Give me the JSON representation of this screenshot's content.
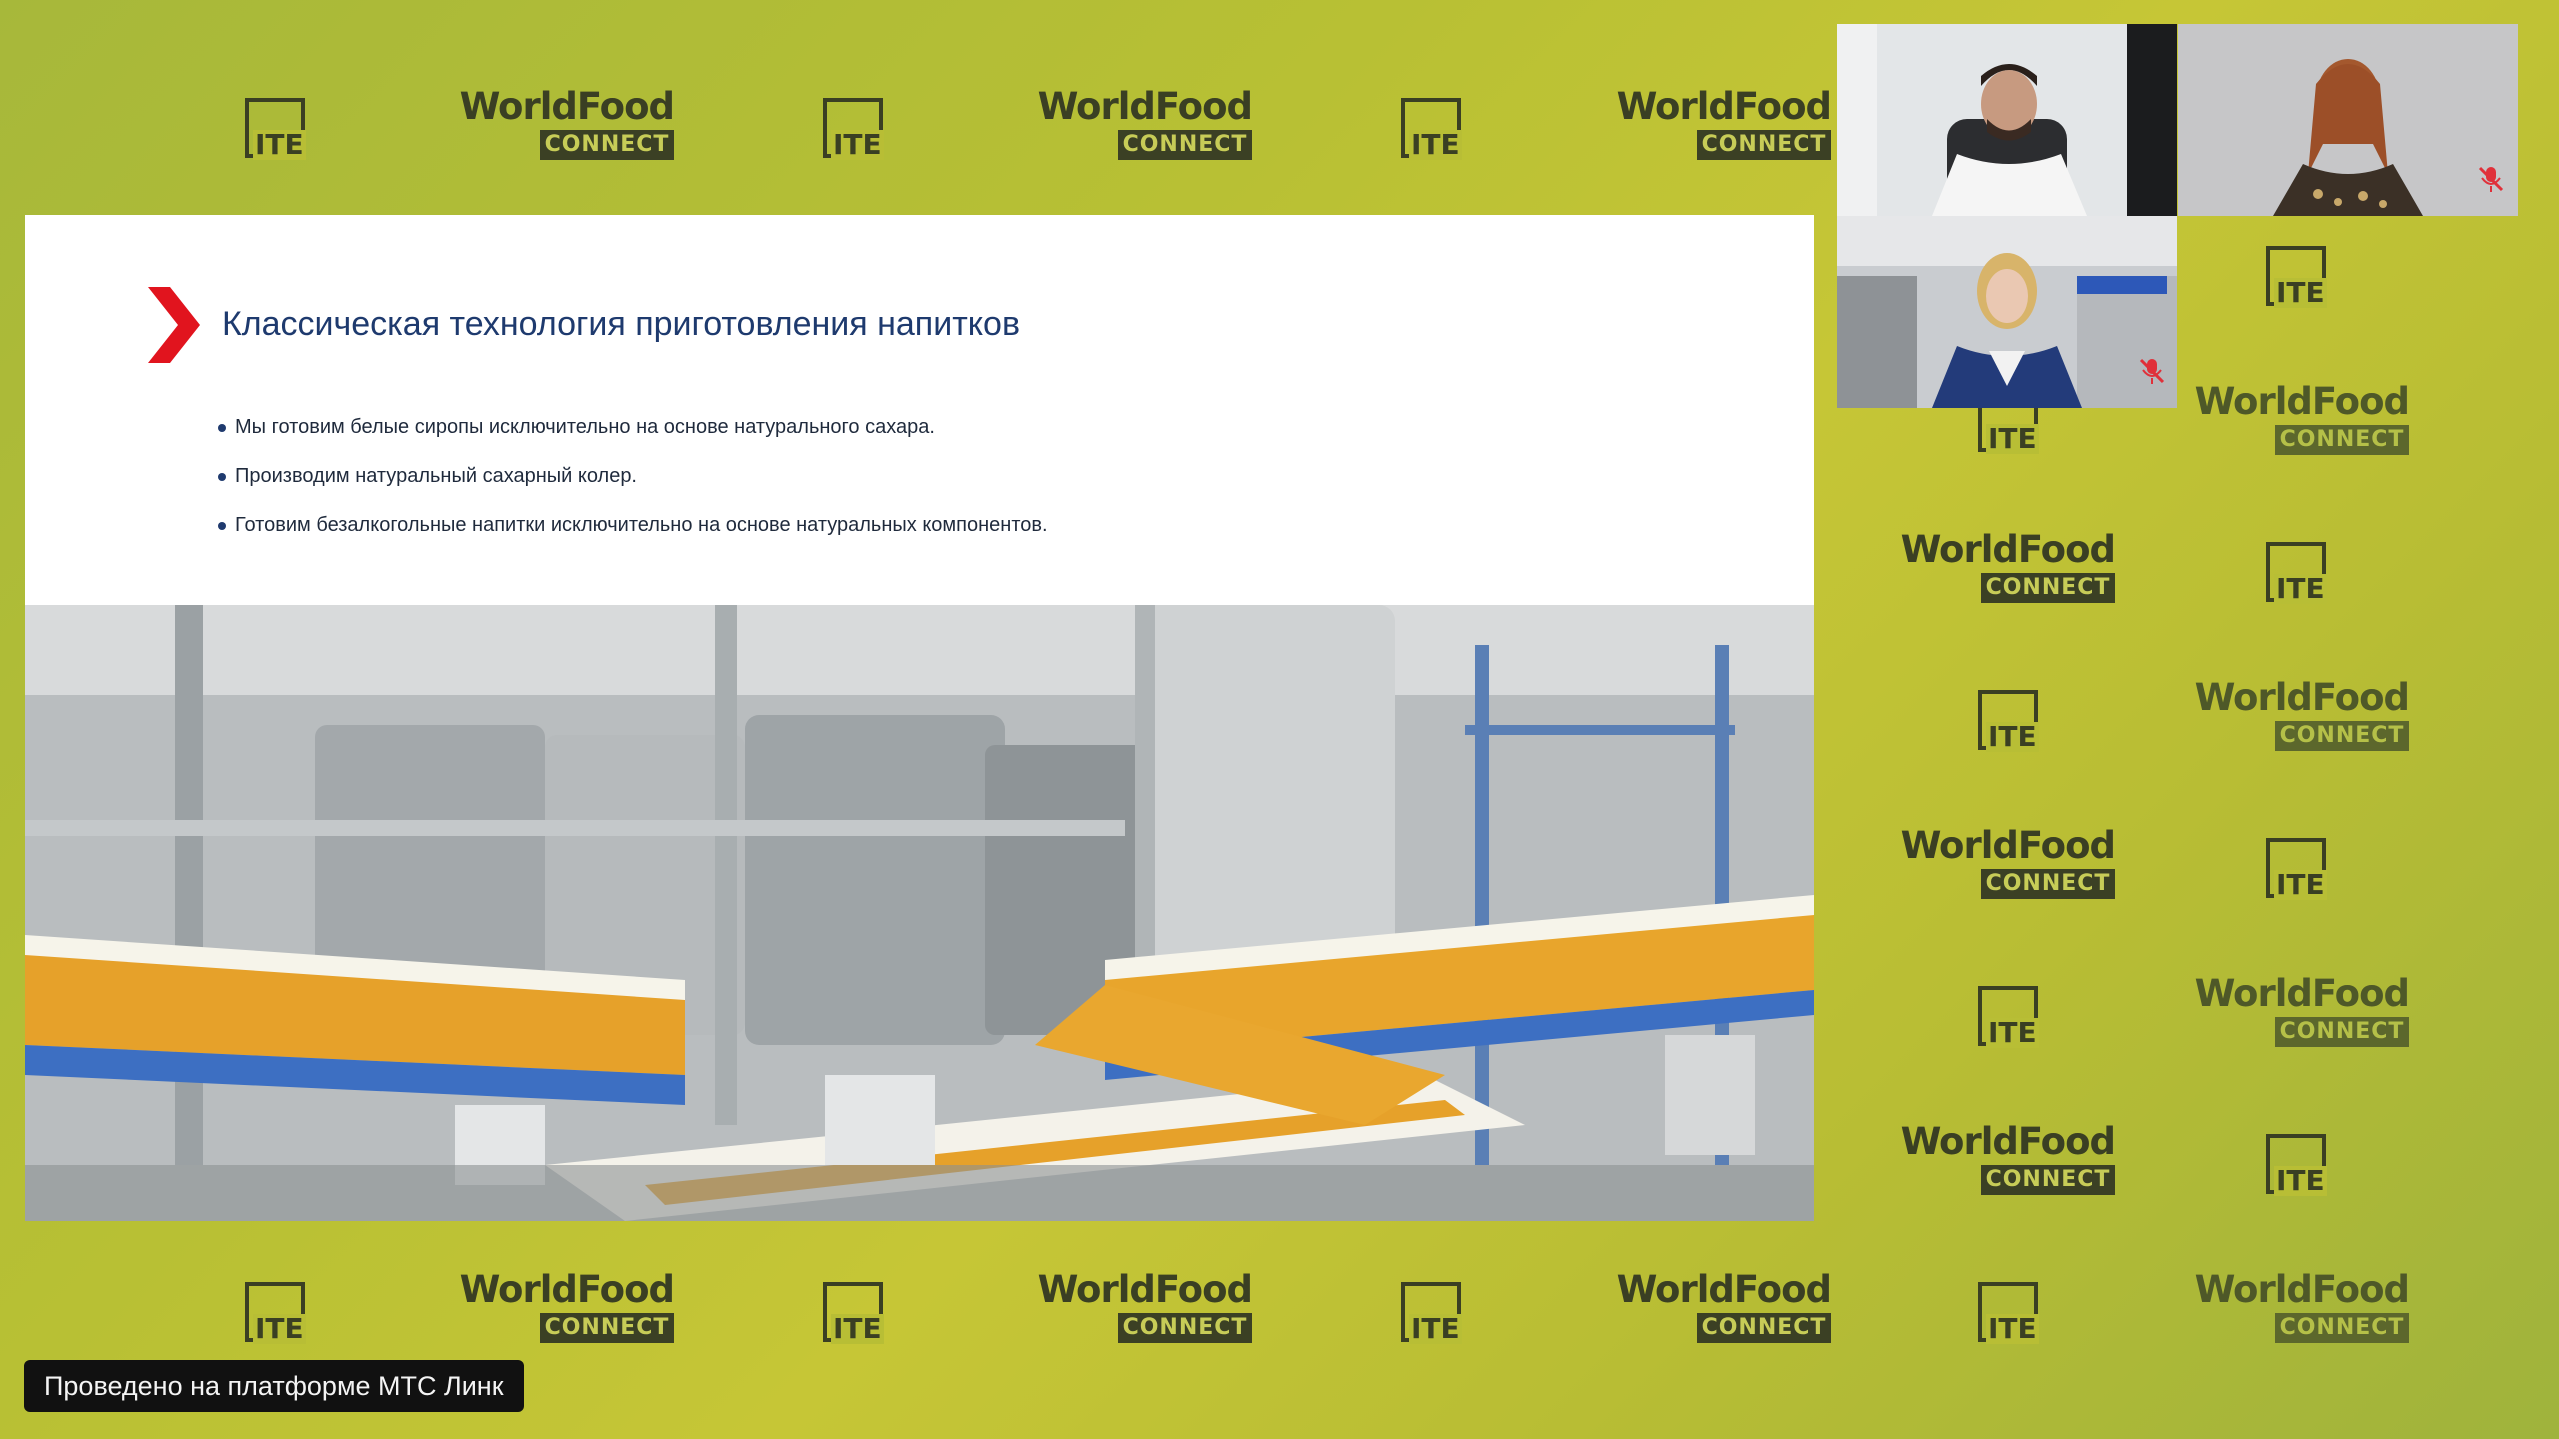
{
  "backdrop": {
    "brand_word": "WorldFood",
    "brand_badge": "CONNECT",
    "ite_word": "ITE",
    "colors": {
      "background": "#b8c034",
      "logo_dark": "#3a3f23",
      "badge_text": "#c7cc57"
    }
  },
  "slide": {
    "title": "Классическая технология приготовления напитков",
    "bullets": [
      "Мы готовим белые сиропы исключительно на основе натурального сахара.",
      "Производим натуральный сахарный колер.",
      "Готовим безалкогольные напитки исключительно на основе натуральных компонентов."
    ],
    "accent_color": "#e1141e",
    "title_color": "#1e3a6e",
    "photo_icon": "beverage-bottling-line-photo"
  },
  "participants": [
    {
      "role": "speaker",
      "icon": "camera-feed-man",
      "muted": false
    },
    {
      "role": "participant",
      "icon": "camera-feed-woman-red-hair",
      "muted": true
    },
    {
      "role": "participant",
      "icon": "camera-feed-woman-blue-jacket",
      "muted": true
    }
  ],
  "platform": {
    "label": "Проведено на платформе МТС Линк"
  }
}
